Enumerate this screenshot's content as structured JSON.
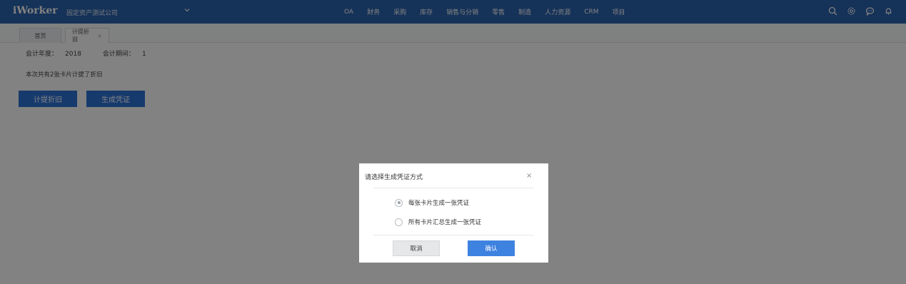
{
  "header": {
    "logo": "iWorker",
    "company": "固定资产测试公司",
    "nav_items": [
      "OA",
      "财务",
      "采购",
      "库存",
      "销售与分销",
      "零售",
      "制造",
      "人力资源",
      "CRM",
      "项目"
    ],
    "icons": [
      "search-icon",
      "settings-icon",
      "chat-icon",
      "bell-icon"
    ],
    "color": "#2a62ad"
  },
  "tabs": [
    {
      "label": "首页"
    },
    {
      "label": "计提折旧",
      "close": "×"
    }
  ],
  "page": {
    "year_label": "会计年度：",
    "year_value": "2018",
    "period_label": "会计期间：",
    "period_value": "1",
    "summary": "本次共有2张卡片计提了折旧",
    "depreciate_button": "计提折旧",
    "voucher_button": "生成凭证",
    "button_color": "#2e73d6"
  },
  "modal": {
    "title": "请选择生成凭证方式",
    "close": "×",
    "options": [
      {
        "label": "每张卡片生成一张凭证",
        "checked": true
      },
      {
        "label": "所有卡片汇总生成一张凭证",
        "checked": false
      }
    ],
    "cancel_label": "取消",
    "ok_label": "确认"
  }
}
